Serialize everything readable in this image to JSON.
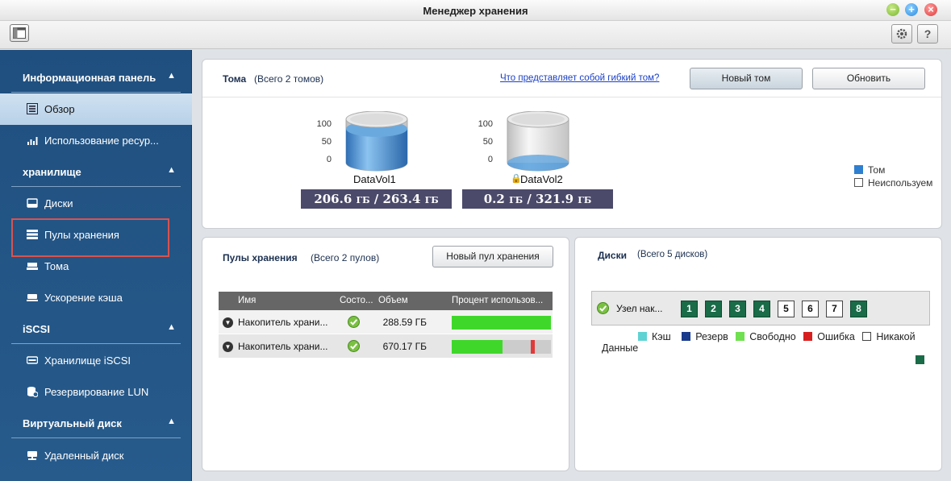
{
  "window": {
    "title": "Менеджер хранения"
  },
  "toolbar": {
    "help_label": "?"
  },
  "sidebar": {
    "sections": [
      {
        "label": "Информационная панель",
        "items": [
          {
            "label": "Обзор",
            "icon": "list-icon",
            "active": true
          },
          {
            "label": "Использование ресур...",
            "icon": "chart-icon"
          }
        ]
      },
      {
        "label": "хранилище",
        "items": [
          {
            "label": "Диски",
            "icon": "disk-icon"
          },
          {
            "label": "Пулы хранения",
            "icon": "pool-icon"
          },
          {
            "label": "Тома",
            "icon": "volume-icon"
          },
          {
            "label": "Ускорение кэша",
            "icon": "cache-icon"
          }
        ]
      },
      {
        "label": "iSCSI",
        "items": [
          {
            "label": "Хранилище iSCSI",
            "icon": "iscsi-icon"
          },
          {
            "label": "Резервирование LUN",
            "icon": "backup-icon"
          }
        ]
      },
      {
        "label": "Виртуальный диск",
        "items": [
          {
            "label": "Удаленный диск",
            "icon": "remote-disk-icon"
          }
        ]
      }
    ]
  },
  "volumes_panel": {
    "title": "Тома",
    "subtitle": "(Всего 2 томов)",
    "help_link": "Что представляет собой гибкий том?",
    "new_button": "Новый том",
    "refresh_button": "Обновить",
    "axis": [
      "100",
      "50",
      "0"
    ],
    "volumes": [
      {
        "name": "DataVol1",
        "used": "206.6",
        "total": "263.4",
        "unit": "ГБ",
        "fill_fraction": 0.78,
        "locked": false
      },
      {
        "name": "DataVol2",
        "used": "0.2",
        "total": "321.9",
        "unit": "ГБ",
        "fill_fraction": 0.0,
        "locked": true
      }
    ],
    "legend": [
      {
        "label": "Том",
        "color": "#2f7fd0"
      },
      {
        "label": "Неиспользуем",
        "color": "#ffffff"
      }
    ]
  },
  "pools_panel": {
    "title": "Пулы хранения",
    "subtitle": "(Всего 2 пулов)",
    "new_button": "Новый пул хранения",
    "columns": [
      "Имя",
      "Состо...",
      "Объем",
      "Процент использов..."
    ],
    "rows": [
      {
        "name": "Накопитель храни...",
        "status": "ok",
        "size": "288.59 ГБ",
        "usage_fraction": 1.0,
        "marker_fraction": null
      },
      {
        "name": "Накопитель храни...",
        "status": "ok",
        "size": "670.17 ГБ",
        "usage_fraction": 0.51,
        "marker_fraction": 0.8
      }
    ]
  },
  "disks_panel": {
    "title": "Диски",
    "subtitle": "(Всего 5 дисков)",
    "node_label": "Узел нак...",
    "slots": [
      {
        "label": "1",
        "used": true
      },
      {
        "label": "2",
        "used": true
      },
      {
        "label": "3",
        "used": true
      },
      {
        "label": "4",
        "used": true
      },
      {
        "label": "5",
        "used": false
      },
      {
        "label": "6",
        "used": false
      },
      {
        "label": "7",
        "used": false
      },
      {
        "label": "8",
        "used": true
      }
    ],
    "legend": [
      {
        "label": "Кэш",
        "color": "#5fd3d3"
      },
      {
        "label": "Резерв",
        "color": "#1a3a8c"
      },
      {
        "label": "Свободно",
        "color": "#6fe04f"
      },
      {
        "label": "Ошибка",
        "color": "#d81f1f"
      },
      {
        "label": "Никакой",
        "color": "#ffffff"
      }
    ],
    "data_legend": {
      "label": "Данные",
      "color": "#1a6b48"
    }
  }
}
